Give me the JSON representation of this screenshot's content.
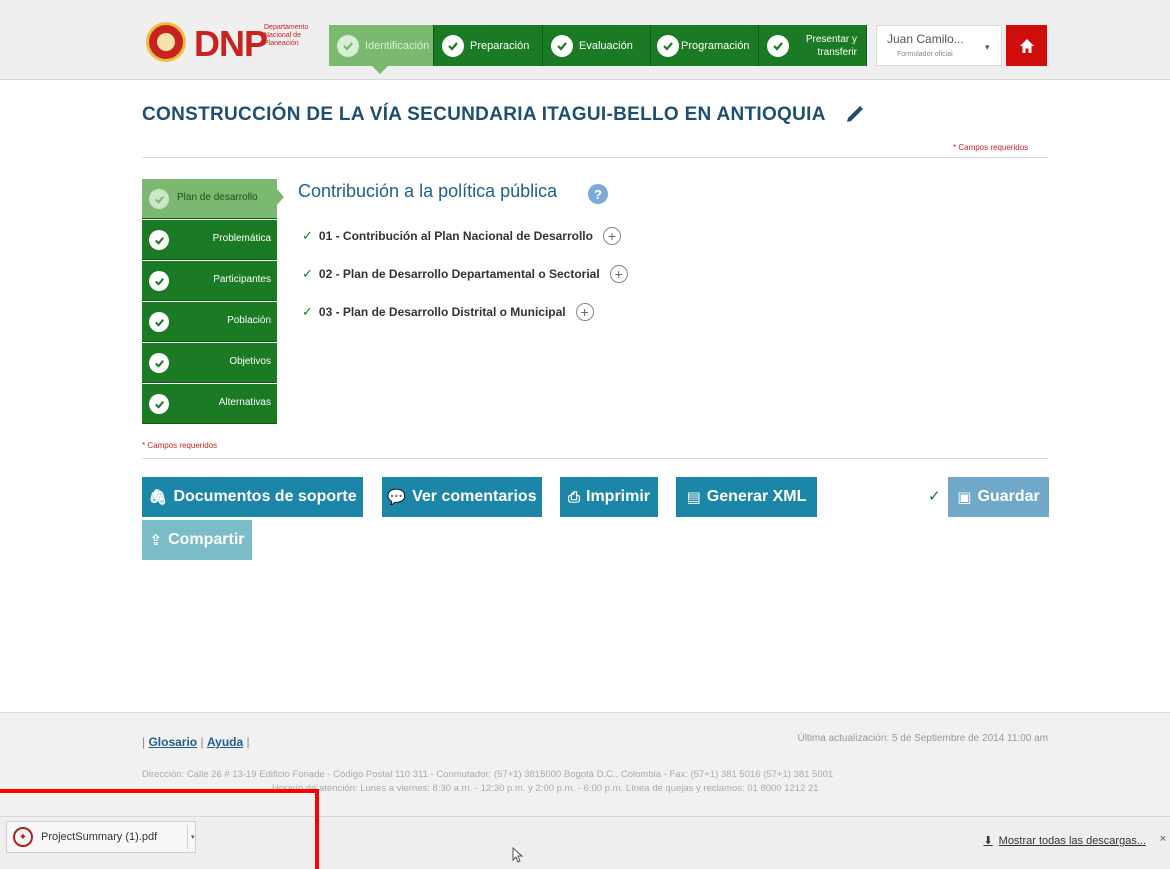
{
  "logo": {
    "brand": "DNP",
    "subtitle": "Departamento Nacional de Planeación"
  },
  "steps": [
    {
      "label": "Identificación",
      "state": "active"
    },
    {
      "label": "Preparación",
      "state": "done"
    },
    {
      "label": "Evaluación",
      "state": "done"
    },
    {
      "label": "Programación",
      "state": "done"
    },
    {
      "label": "Presentar y transferir",
      "state": "done"
    }
  ],
  "user": {
    "name": "Juan Camilo...",
    "role": "Formulador oficial"
  },
  "project": {
    "title": "CONSTRUCCIÓN DE LA VÍA SECUNDARIA ITAGUI-BELLO EN ANTIOQUIA"
  },
  "required_note": "* Campos requeridos",
  "sidebar": {
    "items": [
      {
        "label": "Plan de desarrollo",
        "state": "active"
      },
      {
        "label": "Problemática",
        "state": "done"
      },
      {
        "label": "Participantes",
        "state": "done"
      },
      {
        "label": "Población",
        "state": "done"
      },
      {
        "label": "Objetivos",
        "state": "done"
      },
      {
        "label": "Alternativas",
        "state": "done"
      }
    ]
  },
  "main": {
    "section_title": "Contribución a la política pública",
    "plans": [
      "01 - Contribución al Plan Nacional de Desarrollo",
      "02 - Plan de Desarrollo Departamental o Sectorial",
      "03 - Plan de Desarrollo Distrital o Municipal"
    ]
  },
  "actions": {
    "documents": "Documentos de soporte",
    "comments": "Ver comentarios",
    "print": "Imprimir",
    "xml": "Generar XML",
    "save": "Guardar",
    "share": "Compartir"
  },
  "footer": {
    "glossary": "Glosario",
    "help": "Ayuda",
    "last_update": "Última actualización: 5 de Septiembre de 2014 11:00 am",
    "address": "Dirección: Calle 26 # 13-19 Edificio Fonade - Código Postal 110 311 - Conmutador: (57+1) 3815000 Bogotá D.C., Colombia - Fax: (57+1) 381 5016 (57+1) 381 5001",
    "hours": "Horario de atención: Lunes a viernes: 8:30 a.m. - 12:30 p.m. y 2:00 p.m. - 6:00 p.m. Línea de quejas y reclamos: 01 8000 1212 21"
  },
  "downloads": {
    "file_name": "ProjectSummary (1).pdf",
    "show_all": "Mostrar todas las descargas..."
  },
  "colors": {
    "step_green": "#1b7a24",
    "active_green": "#7ab96f",
    "action_blue": "#1b86a7",
    "title_blue": "#1f4f6e",
    "home_red": "#d00d0d",
    "annotation_red": "#ff0000"
  }
}
